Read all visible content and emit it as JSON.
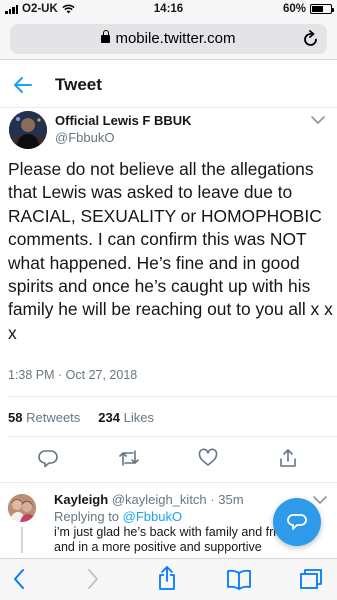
{
  "status_bar": {
    "carrier": "O2-UK",
    "time": "14:16",
    "battery": "60%",
    "battery_level": 0.6
  },
  "browser": {
    "url": "mobile.twitter.com",
    "icons": {
      "lock": "lock-icon",
      "reload": "reload-icon"
    }
  },
  "header": {
    "title": "Tweet",
    "icons": {
      "back": "back-arrow-icon"
    }
  },
  "tweet": {
    "author_name": "Official Lewis F BBUK",
    "handle": "@FbbukO",
    "text": "Please do not believe all the allegations that Lewis was asked to leave due to RACIAL, SEXUALITY or HOMOPHOBIC comments. I can confirm this was NOT what happened. He’s fine and in good spirits and once he’s caught up with his family he will be reaching out to you all x x x",
    "timestamp": "1:38 PM · Oct 27, 2018",
    "retweets_count": "58",
    "retweets_label": "Retweets",
    "likes_count": "234",
    "likes_label": "Likes"
  },
  "actions": [
    "reply-icon",
    "retweet-icon",
    "like-icon",
    "share-icon"
  ],
  "reply": {
    "name": "Kayleigh",
    "handle": "@kayleigh_kitch",
    "age": "· 35m",
    "replying_prefix": "Replying to",
    "replying_handle": "@FbbukO",
    "text": "i’m just glad he’s back with family and friends, and in a more positive and supportive"
  },
  "compose_button": {
    "icon": "compose-reply-icon"
  },
  "safari_toolbar": [
    "back-icon",
    "forward-icon",
    "share-icon",
    "bookmarks-icon",
    "tabs-icon"
  ],
  "colors": {
    "accent": "#1da1f2",
    "fab": "#2e9ae9",
    "secondary_text": "#657786",
    "ios_blue": "#007aff"
  }
}
